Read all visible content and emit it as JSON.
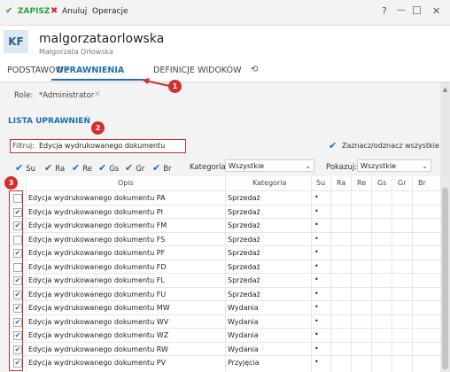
{
  "toolbar": {
    "save_label": "ZAPISZ",
    "cancel_label": "Anuluj",
    "operations_label": "Operacje",
    "help_icon": "?",
    "minimize_icon": "—",
    "maximize_icon": "☐",
    "close_icon": "✕"
  },
  "user": {
    "initials": "KF",
    "login": "malgorzataorlowska",
    "full_name": "Małgorzata Orłowska"
  },
  "tabs": [
    {
      "label": "PODSTAWOWE"
    },
    {
      "label": "UPRAWNIENIA"
    },
    {
      "label": "DEFINICJE WIDOKÓW"
    }
  ],
  "roles": {
    "label": "Role:",
    "value": "*Administrator"
  },
  "section": {
    "title": "LISTA UPRAWNIEŃ"
  },
  "filter": {
    "label": "Filtruj:",
    "value": "Edycja wydrukowanego dokumentu"
  },
  "select_all_label": "Zaznacz/odznacz wszystkie",
  "type_filters": [
    "Su",
    "Ra",
    "Re",
    "Gs",
    "Gr",
    "Br"
  ],
  "category": {
    "label": "Kategoria:",
    "selected": "Wszystkie"
  },
  "show": {
    "label": "Pokazuj:",
    "selected": "Wszystkie"
  },
  "columns": {
    "opis": "Opis",
    "kategoria": "Kategoria",
    "su": "Su",
    "ra": "Ra",
    "re": "Re",
    "gs": "Gs",
    "gr": "Gr",
    "br": "Br"
  },
  "rows": [
    {
      "opis": "Edycja wydrukowanego dokumentu PA",
      "kategoria": "Sprzedaż",
      "checked": false,
      "su": "•"
    },
    {
      "opis": "Edycja wydrukowanego dokumentu PI",
      "kategoria": "Sprzedaż",
      "checked": true,
      "su": "•"
    },
    {
      "opis": "Edycja wydrukowanego dokumentu FM",
      "kategoria": "Sprzedaż",
      "checked": true,
      "su": "•"
    },
    {
      "opis": "Edycja wydrukowanego dokumentu FS",
      "kategoria": "Sprzedaż",
      "checked": false,
      "su": "•"
    },
    {
      "opis": "Edycja wydrukowanego dokumentu PF",
      "kategoria": "Sprzedaż",
      "checked": true,
      "su": "•"
    },
    {
      "opis": "Edycja wydrukowanego dokumentu FD",
      "kategoria": "Sprzedaż",
      "checked": false,
      "su": "•"
    },
    {
      "opis": "Edycja wydrukowanego dokumentu FL",
      "kategoria": "Sprzedaż",
      "checked": true,
      "su": "•"
    },
    {
      "opis": "Edycja wydrukowanego dokumentu FU",
      "kategoria": "Sprzedaż",
      "checked": true,
      "su": "•"
    },
    {
      "opis": "Edycja wydrukowanego dokumentu MW",
      "kategoria": "Wydania",
      "checked": true,
      "su": "•"
    },
    {
      "opis": "Edycja wydrukowanego dokumentu WV",
      "kategoria": "Wydania",
      "checked": true,
      "su": "•"
    },
    {
      "opis": "Edycja wydrukowanego dokumentu WZ",
      "kategoria": "Wydania",
      "checked": true,
      "su": "•"
    },
    {
      "opis": "Edycja wydrukowanego dokumentu RW",
      "kategoria": "Wydania",
      "checked": true,
      "su": "•"
    },
    {
      "opis": "Edycja wydrukowanego dokumentu PV",
      "kategoria": "Przyjęcia",
      "checked": true,
      "su": "•"
    }
  ],
  "badges": [
    "1",
    "2",
    "3"
  ],
  "colors": {
    "accent": "#1e6fb5",
    "annotation": "#d32f2f",
    "save_green": "#2e9e3e",
    "cancel_red": "#d32f2f"
  }
}
